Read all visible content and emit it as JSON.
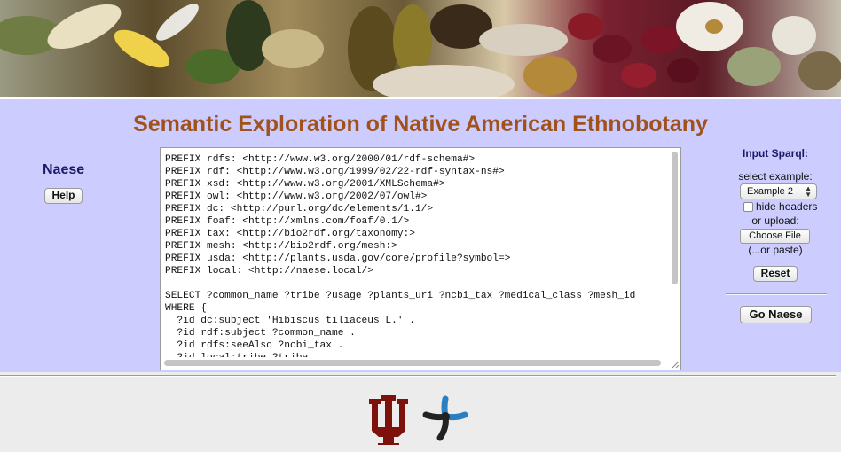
{
  "banner": {
    "icon": "botanical-collage-banner"
  },
  "header": {
    "title": "Semantic Exploration of Native American Ethnobotany"
  },
  "left": {
    "app_name": "Naese",
    "help_label": "Help"
  },
  "query": {
    "text": "PREFIX rdfs: <http://www.w3.org/2000/01/rdf-schema#>\nPREFIX rdf: <http://www.w3.org/1999/02/22-rdf-syntax-ns#>\nPREFIX xsd: <http://www.w3.org/2001/XMLSchema#>\nPREFIX owl: <http://www.w3.org/2002/07/owl#>\nPREFIX dc: <http://purl.org/dc/elements/1.1/>\nPREFIX foaf: <http://xmlns.com/foaf/0.1/>\nPREFIX tax: <http://bio2rdf.org/taxonomy:>\nPREFIX mesh: <http://bio2rdf.org/mesh:>\nPREFIX usda: <http://plants.usda.gov/core/profile?symbol=>\nPREFIX local: <http://naese.local/>\n\nSELECT ?common_name ?tribe ?usage ?plants_uri ?ncbi_tax ?medical_class ?mesh_id\nWHERE {\n  ?id dc:subject 'Hibiscus tiliaceus L.' .\n  ?id rdf:subject ?common_name .\n  ?id rdfs:seeAlso ?ncbi_tax .\n  ?id local:tribe ?tribe ."
  },
  "right": {
    "input_label": "Input Sparql:",
    "select_example_label": "select example:",
    "example_selected": "Example 2",
    "hide_headers_label": "hide headers",
    "hide_headers_checked": false,
    "or_upload_label": "or upload:",
    "choose_file_label": "Choose File",
    "or_paste_label": "(...or paste)",
    "reset_label": "Reset",
    "go_label": "Go Naese"
  },
  "footer": {
    "logos": [
      "indiana-university-trident-logo",
      "network-y-logo"
    ]
  },
  "colors": {
    "panel_bg": "#ccccff",
    "title": "#a0521a",
    "label_navy": "#1a1a66",
    "iu_crimson": "#7d110c",
    "nexus_blue": "#2b7fc1"
  }
}
